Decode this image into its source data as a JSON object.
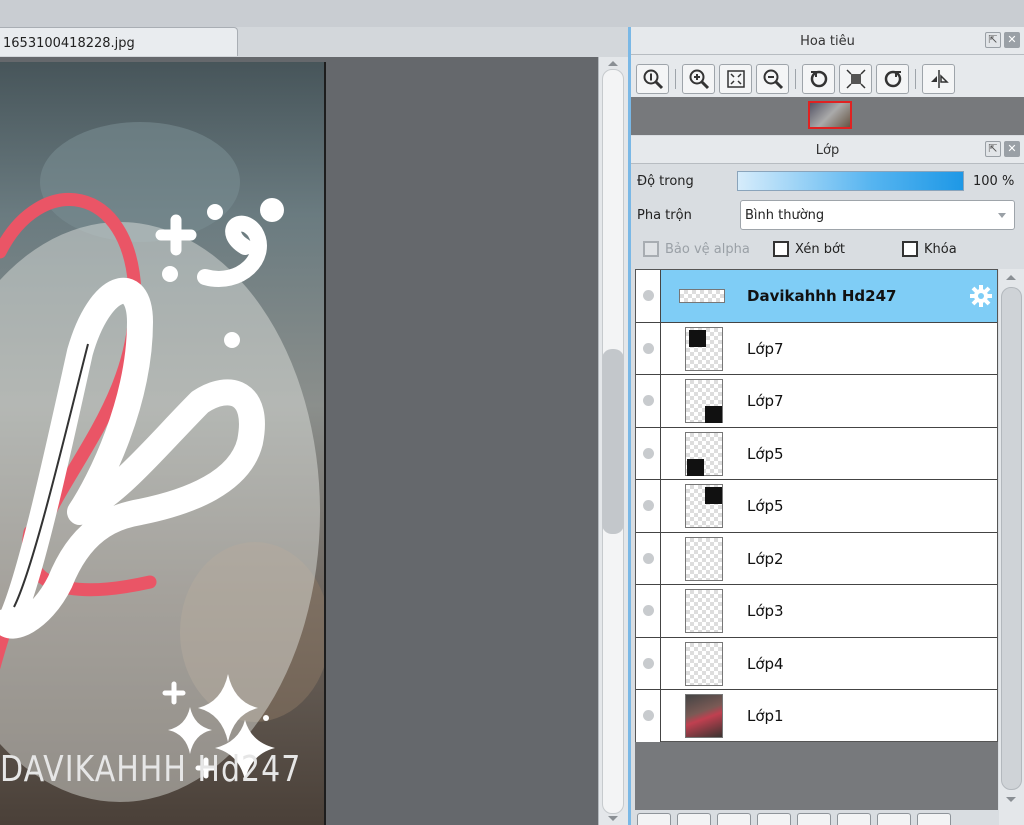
{
  "document": {
    "tab_title": "1653100418228.jpg"
  },
  "canvas": {
    "watermark": "DAVIKAHHH Hd247"
  },
  "navigator": {
    "title": "Hoa tiêu",
    "tools": [
      "zoom-reset-icon",
      "zoom-in-icon",
      "fit-screen-icon",
      "zoom-out-icon",
      "rotate-left-icon",
      "fit-actual-icon",
      "rotate-right-icon",
      "flip-horizontal-icon"
    ]
  },
  "layers_panel": {
    "title": "Lớp",
    "opacity_label": "Độ trong",
    "opacity_value": "100 %",
    "opacity_fraction": 1.0,
    "blend_label": "Pha trộn",
    "blend_value": "Bình thường",
    "protect_alpha_label": "Bảo vệ alpha",
    "clip_label": "Xén bớt",
    "lock_label": "Khóa",
    "layers": [
      {
        "name": "Davikahhh Hd247",
        "selected": true
      },
      {
        "name": "Lớp7"
      },
      {
        "name": "Lớp7"
      },
      {
        "name": "Lớp5"
      },
      {
        "name": "Lớp5"
      },
      {
        "name": "Lớp2"
      },
      {
        "name": "Lớp3"
      },
      {
        "name": "Lớp4"
      },
      {
        "name": "Lớp1"
      }
    ]
  },
  "colors": {
    "accent": "#1e98e6",
    "selection": "#7fcdf6",
    "preview_border": "#e02222"
  }
}
